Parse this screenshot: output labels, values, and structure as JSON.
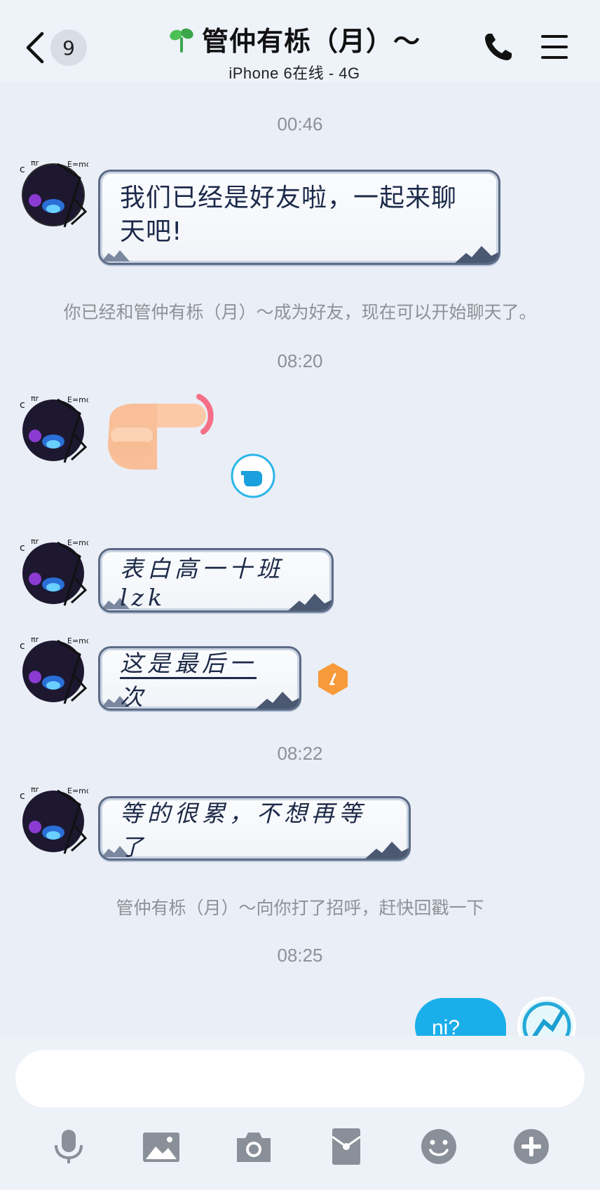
{
  "header": {
    "back_count": "9",
    "title": "管仲有栎（月）～",
    "subtitle": "iPhone 6在线 - 4G"
  },
  "chat": {
    "time1": "00:46",
    "msg1": "我们已经是好友啦，一起来聊天吧!",
    "sys1": "你已经和管仲有栎（月）～成为好友，现在可以开始聊天了。",
    "time2": "08:20",
    "msg2": "表白高一十班lzk",
    "msg3": "这是最后一次",
    "time3": "08:22",
    "msg4": "等的很累，不想再等了",
    "sys2": "管仲有栎（月）～向你打了招呼，赶快回戳一下",
    "time4": "08:25",
    "self_msg": "ni?"
  },
  "input": {
    "placeholder": ""
  },
  "colors": {
    "self_bubble": "#1aaeea",
    "bubble_border": "#5b6b86",
    "timestamp": "#8e9196",
    "toolbar_icon": "#8a9099"
  },
  "toolbar": {
    "icons": [
      "microphone-icon",
      "image-icon",
      "camera-icon",
      "red-packet-icon",
      "emoji-icon",
      "plus-icon"
    ]
  }
}
